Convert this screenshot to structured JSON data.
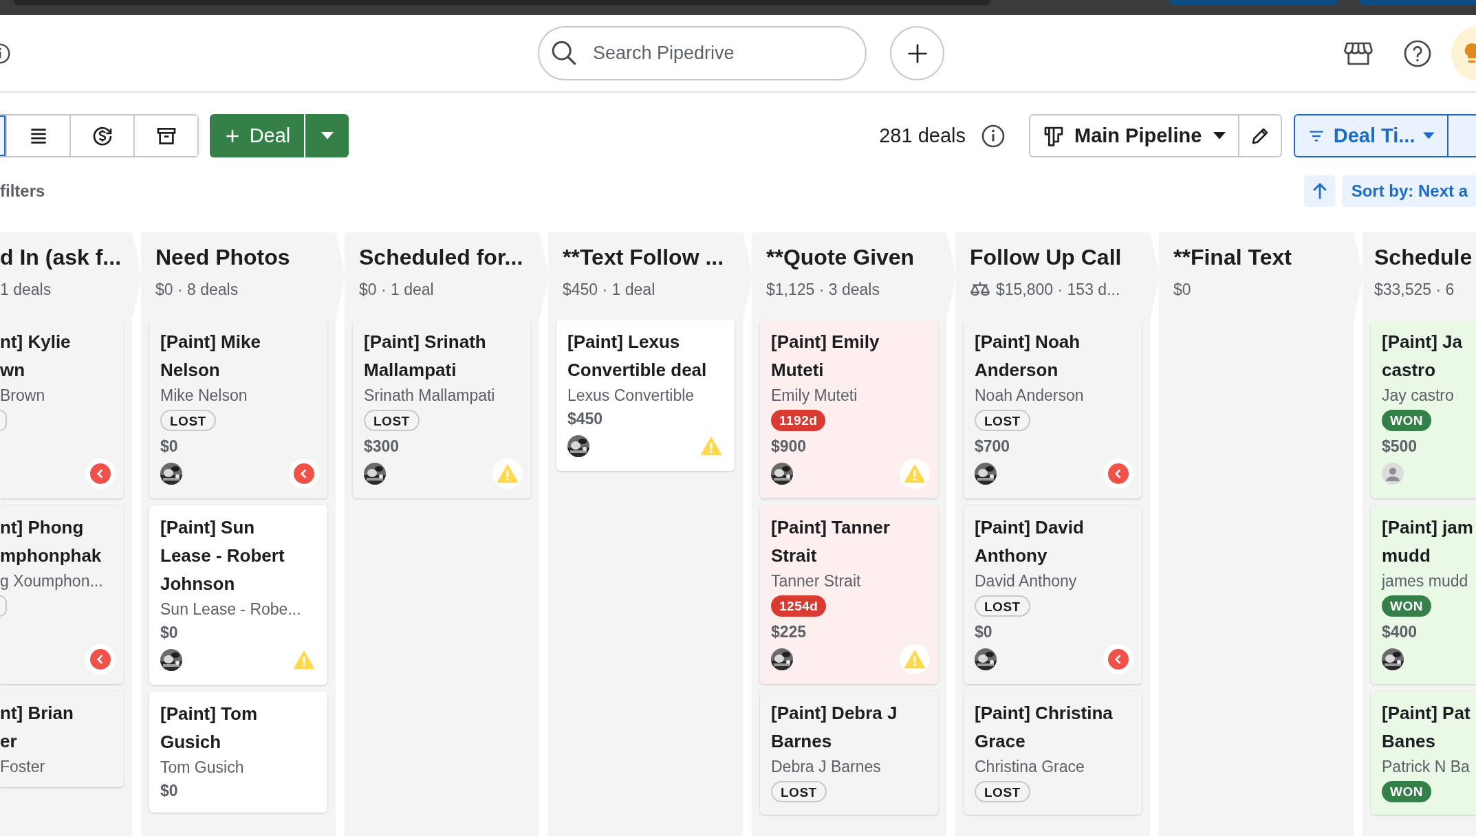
{
  "header": {
    "search": {
      "placeholder": "Search Pipedrive"
    }
  },
  "toolbar": {
    "views": [
      {
        "kind": "board",
        "selected": true
      },
      {
        "kind": "list",
        "selected": false
      },
      {
        "kind": "forecast",
        "selected": false
      },
      {
        "kind": "archive",
        "selected": false
      }
    ],
    "add_button": "Deal",
    "deal_count": "281 deals",
    "pipeline": "Main Pipeline",
    "filter": "Deal Ti...",
    "sort": "Sort by: Next a"
  },
  "filters_label": "filters",
  "stages": [
    {
      "title": "d In (ask f...",
      "summary": "1 deals",
      "weighted": false,
      "cards": [
        {
          "title": "nt] Kylie\nwn",
          "contact": "Brown",
          "kind": "lost",
          "badge": {
            "kind": "lost"
          },
          "alert": {
            "kind": "overdue"
          }
        },
        {
          "title": "nt] Phong\nmphonphak",
          "contact": "g Xoumphon...",
          "kind": "lost",
          "badge": {
            "kind": "lost"
          },
          "alert": {
            "kind": "overdue"
          }
        },
        {
          "title": "nt] Brian\ner",
          "contact": "Foster",
          "kind": "lost"
        }
      ]
    },
    {
      "title": "Need Photos",
      "summary": "$0 · 8 deals",
      "weighted": false,
      "cards": [
        {
          "title": "[Paint] Mike\nNelson",
          "contact": "Mike Nelson",
          "kind": "lost",
          "badge": {
            "kind": "lost",
            "text": "LOST"
          },
          "value": "$0",
          "alert": {
            "kind": "overdue"
          }
        },
        {
          "title": "[Paint] Sun\nLease - Robert\nJohnson",
          "contact": "Sun Lease - Robe...",
          "kind": "open",
          "value": "$0",
          "alert": {
            "kind": "warning"
          }
        },
        {
          "title": "[Paint] Tom\nGusich",
          "contact": "Tom Gusich",
          "kind": "open",
          "value": "$0"
        }
      ]
    },
    {
      "title": "Scheduled for...",
      "summary": "$0 · 1 deal",
      "weighted": false,
      "cards": [
        {
          "title": "[Paint] Srinath\nMallampati",
          "contact": "Srinath Mallampati",
          "kind": "lost",
          "badge": {
            "kind": "lost",
            "text": "LOST"
          },
          "value": "$300",
          "alert": {
            "kind": "warning"
          }
        }
      ]
    },
    {
      "title": "**Text Follow ...",
      "summary": "$450 · 1 deal",
      "weighted": false,
      "cards": [
        {
          "title": "[Paint] Lexus\nConvertible deal",
          "contact": "Lexus Convertible",
          "kind": "open",
          "value": "$450",
          "alert": {
            "kind": "warning"
          }
        }
      ]
    },
    {
      "title": "**Quote Given",
      "summary": "$1,125 · 3 deals",
      "weighted": false,
      "cards": [
        {
          "title": "[Paint] Emily\nMuteti",
          "contact": "Emily Muteti",
          "kind": "rotten",
          "badge": {
            "kind": "rotten",
            "text": "1192d"
          },
          "value": "$900",
          "alert": {
            "kind": "warning"
          }
        },
        {
          "title": "[Paint] Tanner\nStrait",
          "contact": "Tanner Strait",
          "kind": "rotten",
          "badge": {
            "kind": "rotten",
            "text": "1254d"
          },
          "value": "$225",
          "alert": {
            "kind": "warning"
          }
        },
        {
          "title": "[Paint] Debra J\nBarnes",
          "contact": "Debra J Barnes",
          "kind": "lost",
          "badge": {
            "kind": "lost",
            "text": "LOST"
          }
        }
      ]
    },
    {
      "title": "Follow Up Call",
      "summary": "$15,800 · 153 d...",
      "weighted": true,
      "cards": [
        {
          "title": "[Paint] Noah\nAnderson",
          "contact": "Noah Anderson",
          "kind": "lost",
          "badge": {
            "kind": "lost",
            "text": "LOST"
          },
          "value": "$700",
          "alert": {
            "kind": "overdue"
          }
        },
        {
          "title": "[Paint] David\nAnthony",
          "contact": "David Anthony",
          "kind": "lost",
          "badge": {
            "kind": "lost",
            "text": "LOST"
          },
          "value": "$0",
          "alert": {
            "kind": "overdue"
          }
        },
        {
          "title": "[Paint] Christina\nGrace",
          "contact": "Christina Grace",
          "kind": "lost",
          "badge": {
            "kind": "lost",
            "text": "LOST"
          }
        }
      ]
    },
    {
      "title": "**Final Text",
      "summary": "$0",
      "weighted": false
    },
    {
      "title": "Schedule",
      "summary": "$33,525 · 6",
      "weighted": false,
      "cards": [
        {
          "title": "[Paint] Ja\ncastro",
          "contact": "Jay castro",
          "kind": "won",
          "badge": {
            "kind": "won",
            "text": "WON"
          },
          "value": "$500",
          "avatar": {
            "kind": "placeholder"
          }
        },
        {
          "title": "[Paint] jam\nmudd",
          "contact": "james mudd",
          "kind": "won",
          "badge": {
            "kind": "won",
            "text": "WON"
          },
          "value": "$400"
        },
        {
          "title": "[Paint] Pat\nBanes",
          "contact": "Patrick N Ba",
          "kind": "won",
          "badge": {
            "kind": "won",
            "text": "WON"
          }
        }
      ]
    }
  ]
}
